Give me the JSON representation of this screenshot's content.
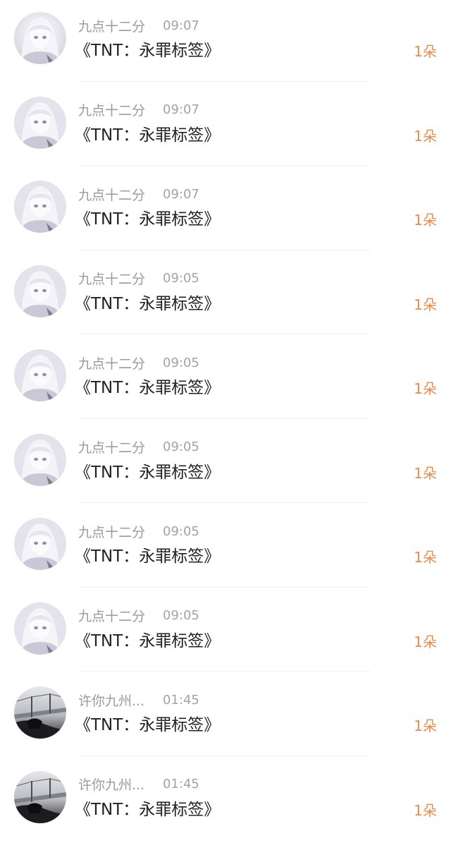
{
  "colors": {
    "background": "#ffffff",
    "name_gray": "#9a9a9a",
    "title_text": "#222222",
    "gift_orange": "#ee8a4b",
    "divider": "#f1f1f1"
  },
  "gift_records": [
    {
      "avatar": "anime-girl-avatar",
      "name": "九点十二分",
      "time": "09:07",
      "title": "《TNT：永罪标签》",
      "count": "1朵"
    },
    {
      "avatar": "anime-girl-avatar",
      "name": "九点十二分",
      "time": "09:07",
      "title": "《TNT：永罪标签》",
      "count": "1朵"
    },
    {
      "avatar": "anime-girl-avatar",
      "name": "九点十二分",
      "time": "09:07",
      "title": "《TNT：永罪标签》",
      "count": "1朵"
    },
    {
      "avatar": "anime-girl-avatar",
      "name": "九点十二分",
      "time": "09:05",
      "title": "《TNT：永罪标签》",
      "count": "1朵"
    },
    {
      "avatar": "anime-girl-avatar",
      "name": "九点十二分",
      "time": "09:05",
      "title": "《TNT：永罪标签》",
      "count": "1朵"
    },
    {
      "avatar": "anime-girl-avatar",
      "name": "九点十二分",
      "time": "09:05",
      "title": "《TNT：永罪标签》",
      "count": "1朵"
    },
    {
      "avatar": "anime-girl-avatar",
      "name": "九点十二分",
      "time": "09:05",
      "title": "《TNT：永罪标签》",
      "count": "1朵"
    },
    {
      "avatar": "anime-girl-avatar",
      "name": "九点十二分",
      "time": "09:05",
      "title": "《TNT：永罪标签》",
      "count": "1朵"
    },
    {
      "avatar": "bridge-photo-avatar",
      "name": "许你九州...",
      "time": "01:45",
      "title": "《TNT：永罪标签》",
      "count": "1朵"
    },
    {
      "avatar": "bridge-photo-avatar",
      "name": "许你九州...",
      "time": "01:45",
      "title": "《TNT：永罪标签》",
      "count": "1朵"
    }
  ]
}
